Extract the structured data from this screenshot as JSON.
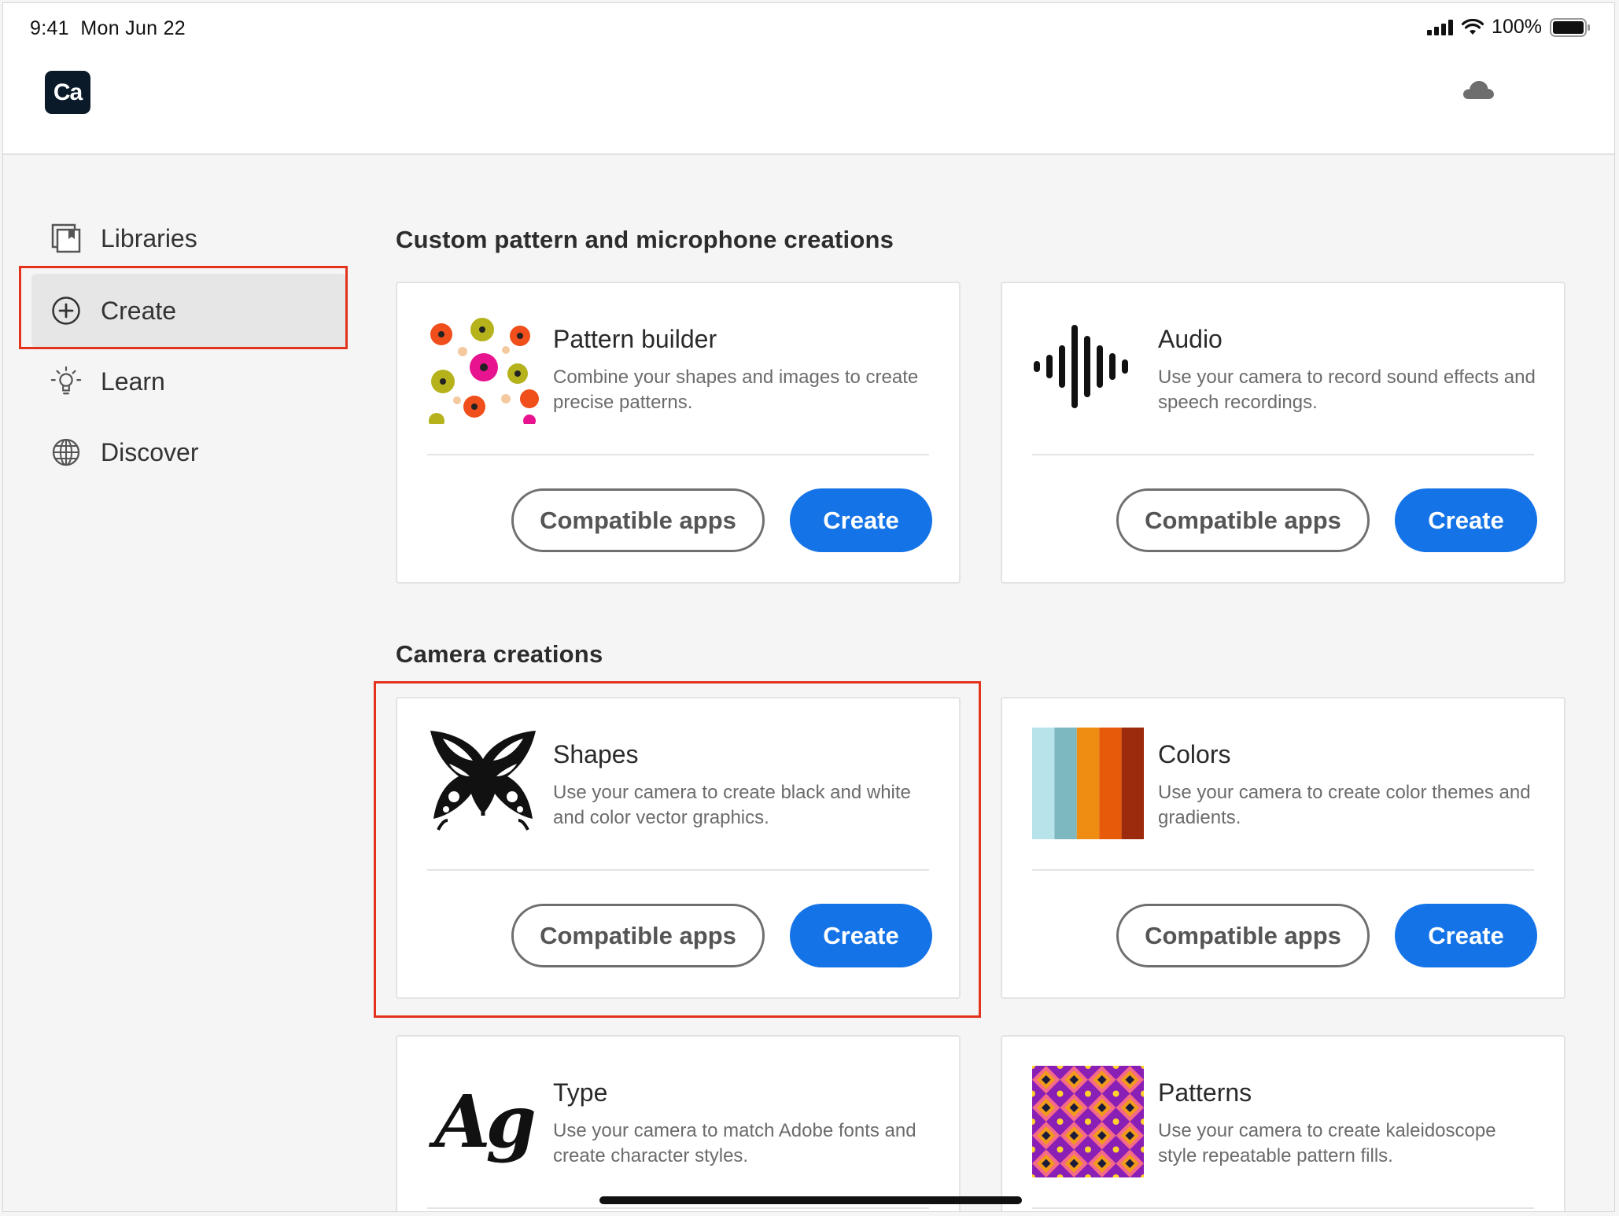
{
  "status_bar": {
    "time": "9:41",
    "date": "Mon Jun 22",
    "battery": "100%"
  },
  "app": {
    "logo_text": "Ca"
  },
  "sidebar": {
    "items": [
      {
        "label": "Libraries",
        "icon": "libraries-icon"
      },
      {
        "label": "Create",
        "icon": "plus-circle-icon",
        "active": true
      },
      {
        "label": "Learn",
        "icon": "lightbulb-icon"
      },
      {
        "label": "Discover",
        "icon": "globe-icon"
      }
    ]
  },
  "sections": {
    "custom": {
      "title": "Custom pattern and microphone creations"
    },
    "camera": {
      "title": "Camera creations"
    }
  },
  "cards": {
    "pattern_builder": {
      "title": "Pattern builder",
      "desc": "Combine your shapes and images to create precise patterns.",
      "secondary": "Compatible apps",
      "primary": "Create"
    },
    "audio": {
      "title": "Audio",
      "desc": "Use your camera to record sound effects and speech recordings.",
      "secondary": "Compatible apps",
      "primary": "Create"
    },
    "shapes": {
      "title": "Shapes",
      "desc": "Use your camera to create black and white and color vector graphics.",
      "secondary": "Compatible apps",
      "primary": "Create"
    },
    "colors": {
      "title": "Colors",
      "desc": "Use your camera to create color themes and gradients.",
      "secondary": "Compatible apps",
      "primary": "Create"
    },
    "type": {
      "title": "Type",
      "desc": "Use your camera to match Adobe fonts and create character styles.",
      "thumb_text": "Ag"
    },
    "patterns": {
      "title": "Patterns",
      "desc": "Use your camera to create kaleidoscope style repeatable pattern fills."
    }
  },
  "colors": {
    "accent": "#1473e6",
    "highlight": "#e3331d",
    "swatches": [
      "#b7e3ea",
      "#7db7bf",
      "#ef8c12",
      "#e65a0a",
      "#9c2a0c"
    ]
  }
}
